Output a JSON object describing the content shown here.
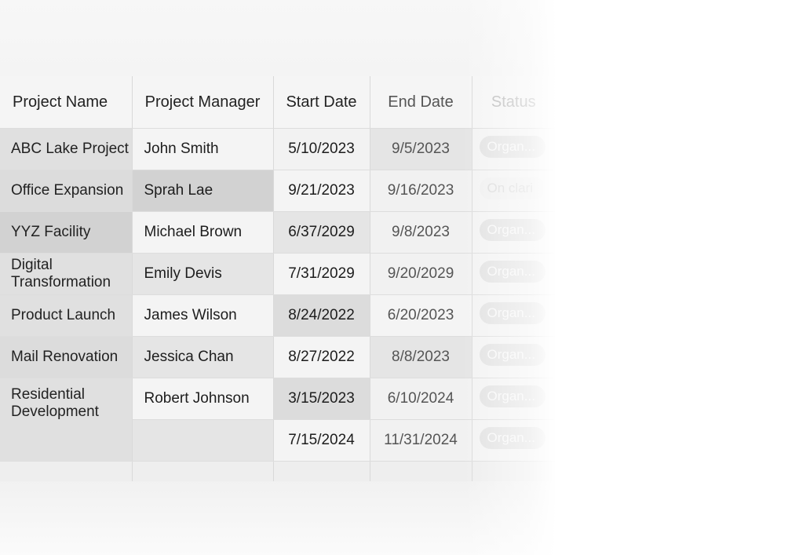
{
  "table": {
    "headers": [
      "Project Name",
      "Project Manager",
      "Start Date",
      "End Date",
      "Status"
    ],
    "rows": [
      {
        "project": "ABC Lake Project",
        "manager": "John Smith",
        "start": "5/10/2023",
        "end": "9/5/2023",
        "status": "Organ..."
      },
      {
        "project": "Office Expansion",
        "manager": "Sprah Lae",
        "start": "9/21/2023",
        "end": "9/16/2023",
        "status": "On clari"
      },
      {
        "project": "YYZ Facility",
        "manager": "Michael Brown",
        "start": "6/37/2029",
        "end": "9/8/2023",
        "status": "Organ..."
      },
      {
        "project": "Digital Transformation",
        "manager": "Emily Devis",
        "start": "7/31/2029",
        "end": "9/20/2029",
        "status": "Organ..."
      },
      {
        "project": "Product Launch",
        "manager": "James Wilson",
        "start": "8/24/2022",
        "end": "6/20/2023",
        "status": "Organ..."
      },
      {
        "project": "Mail Renovation",
        "manager": "Jessica Chan",
        "start": "8/27/2022",
        "end": "8/8/2023",
        "status": "Organ..."
      },
      {
        "project": "Residential Development",
        "manager": "Robert Johnson",
        "start": "3/15/2023",
        "end": "6/10/2024",
        "status": "Organ..."
      },
      {
        "project": "",
        "manager": "",
        "start": "7/15/2024",
        "end": "11/31/2024",
        "status": "Organ..."
      }
    ]
  }
}
